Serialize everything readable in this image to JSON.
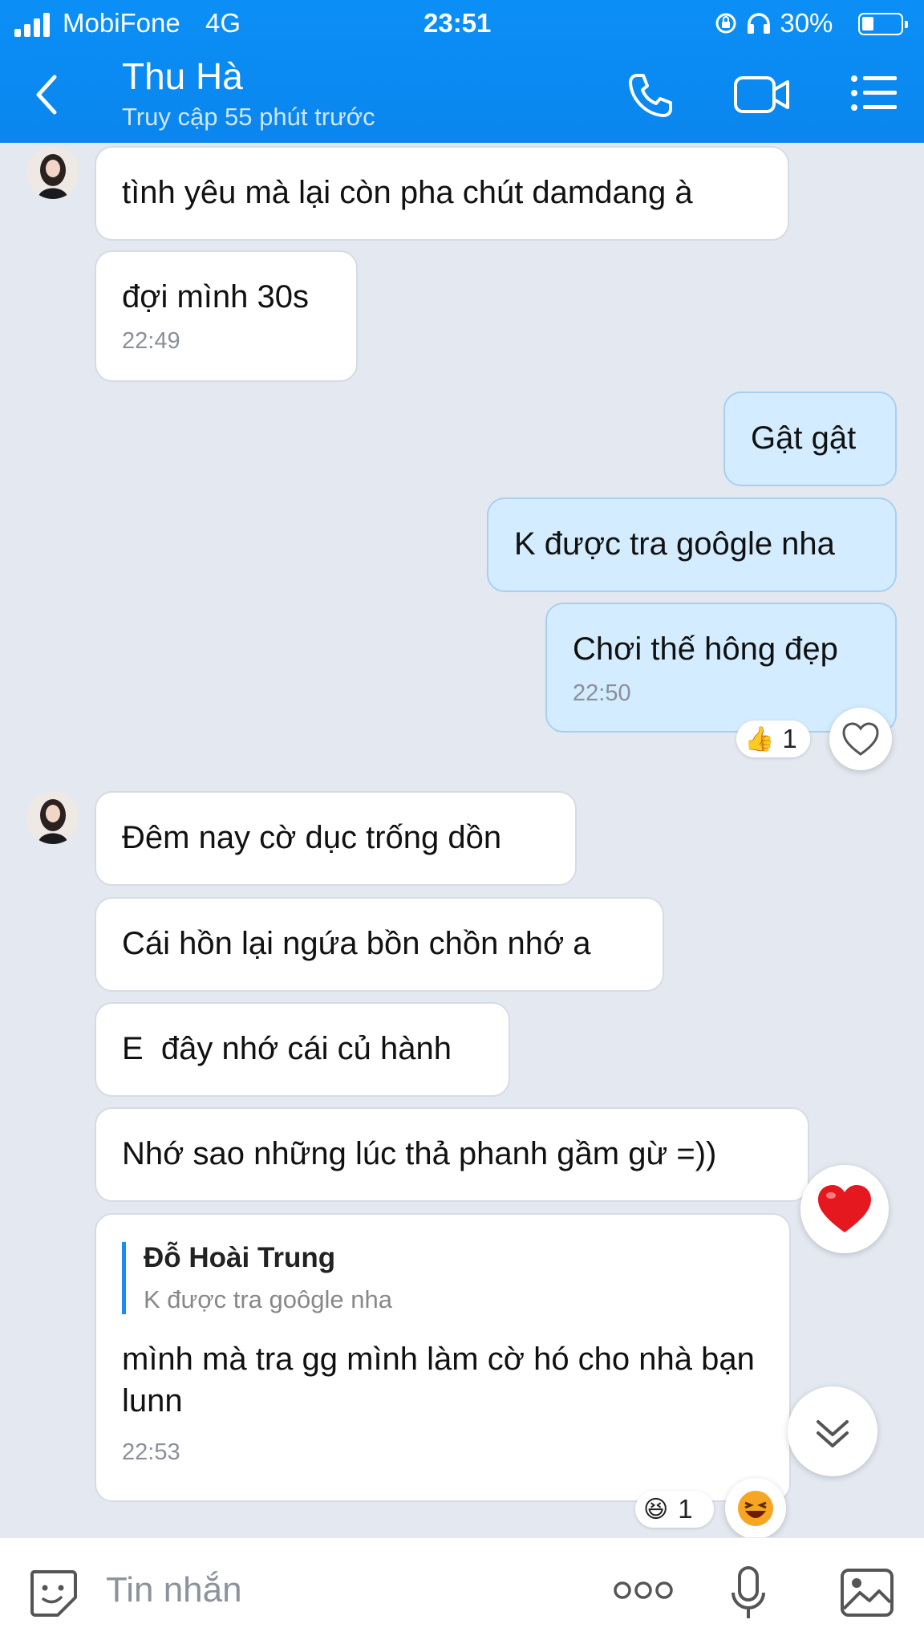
{
  "status": {
    "carrier": "MobiFone",
    "network": "4G",
    "time": "23:51",
    "battery": "30%"
  },
  "header": {
    "contact_name": "Thu Hà",
    "last_seen": "Truy cập 55 phút trước",
    "icons": [
      "back-arrow-icon",
      "phone-icon",
      "video-camera-icon",
      "menu-list-icon"
    ]
  },
  "messages": [
    {
      "dir": "in",
      "text": "tình yêu mà lại còn pha chút damdang à"
    },
    {
      "dir": "in",
      "text": "đợi mình 30s",
      "time": "22:49"
    },
    {
      "dir": "out",
      "text": "Gật gật"
    },
    {
      "dir": "out",
      "text": "K được tra goôgle nha"
    },
    {
      "dir": "out",
      "text": "Chơi thế hông đẹp",
      "time": "22:50",
      "reaction": {
        "emoji": "👍",
        "count": "1"
      }
    },
    {
      "dir": "in",
      "text": "Đêm nay cờ dục trống dồn"
    },
    {
      "dir": "in",
      "text": "Cái hồn lại ngứa bồn chồn nhớ a"
    },
    {
      "dir": "in",
      "text": "E  đây nhớ cái củ hành"
    },
    {
      "dir": "in",
      "text": "Nhớ sao những lúc thả phanh gầm gừ =))"
    },
    {
      "dir": "in",
      "reply_to": {
        "name": "Đỗ Hoài Trung",
        "text": "K được tra goôgle nha"
      },
      "text": "mình mà tra gg mình làm cờ hó cho nhà bạn lunn",
      "time": "22:53",
      "reaction": {
        "emoji": "😆",
        "count": "1"
      }
    }
  ],
  "composer": {
    "placeholder": "Tin nhắn",
    "icons": [
      "sticker-icon",
      "more-dots-icon",
      "microphone-icon",
      "image-icon"
    ]
  },
  "colors": {
    "header": "#0a86ee",
    "outgoing_bubble": "#d4ecff",
    "background": "#e3e8f1"
  }
}
